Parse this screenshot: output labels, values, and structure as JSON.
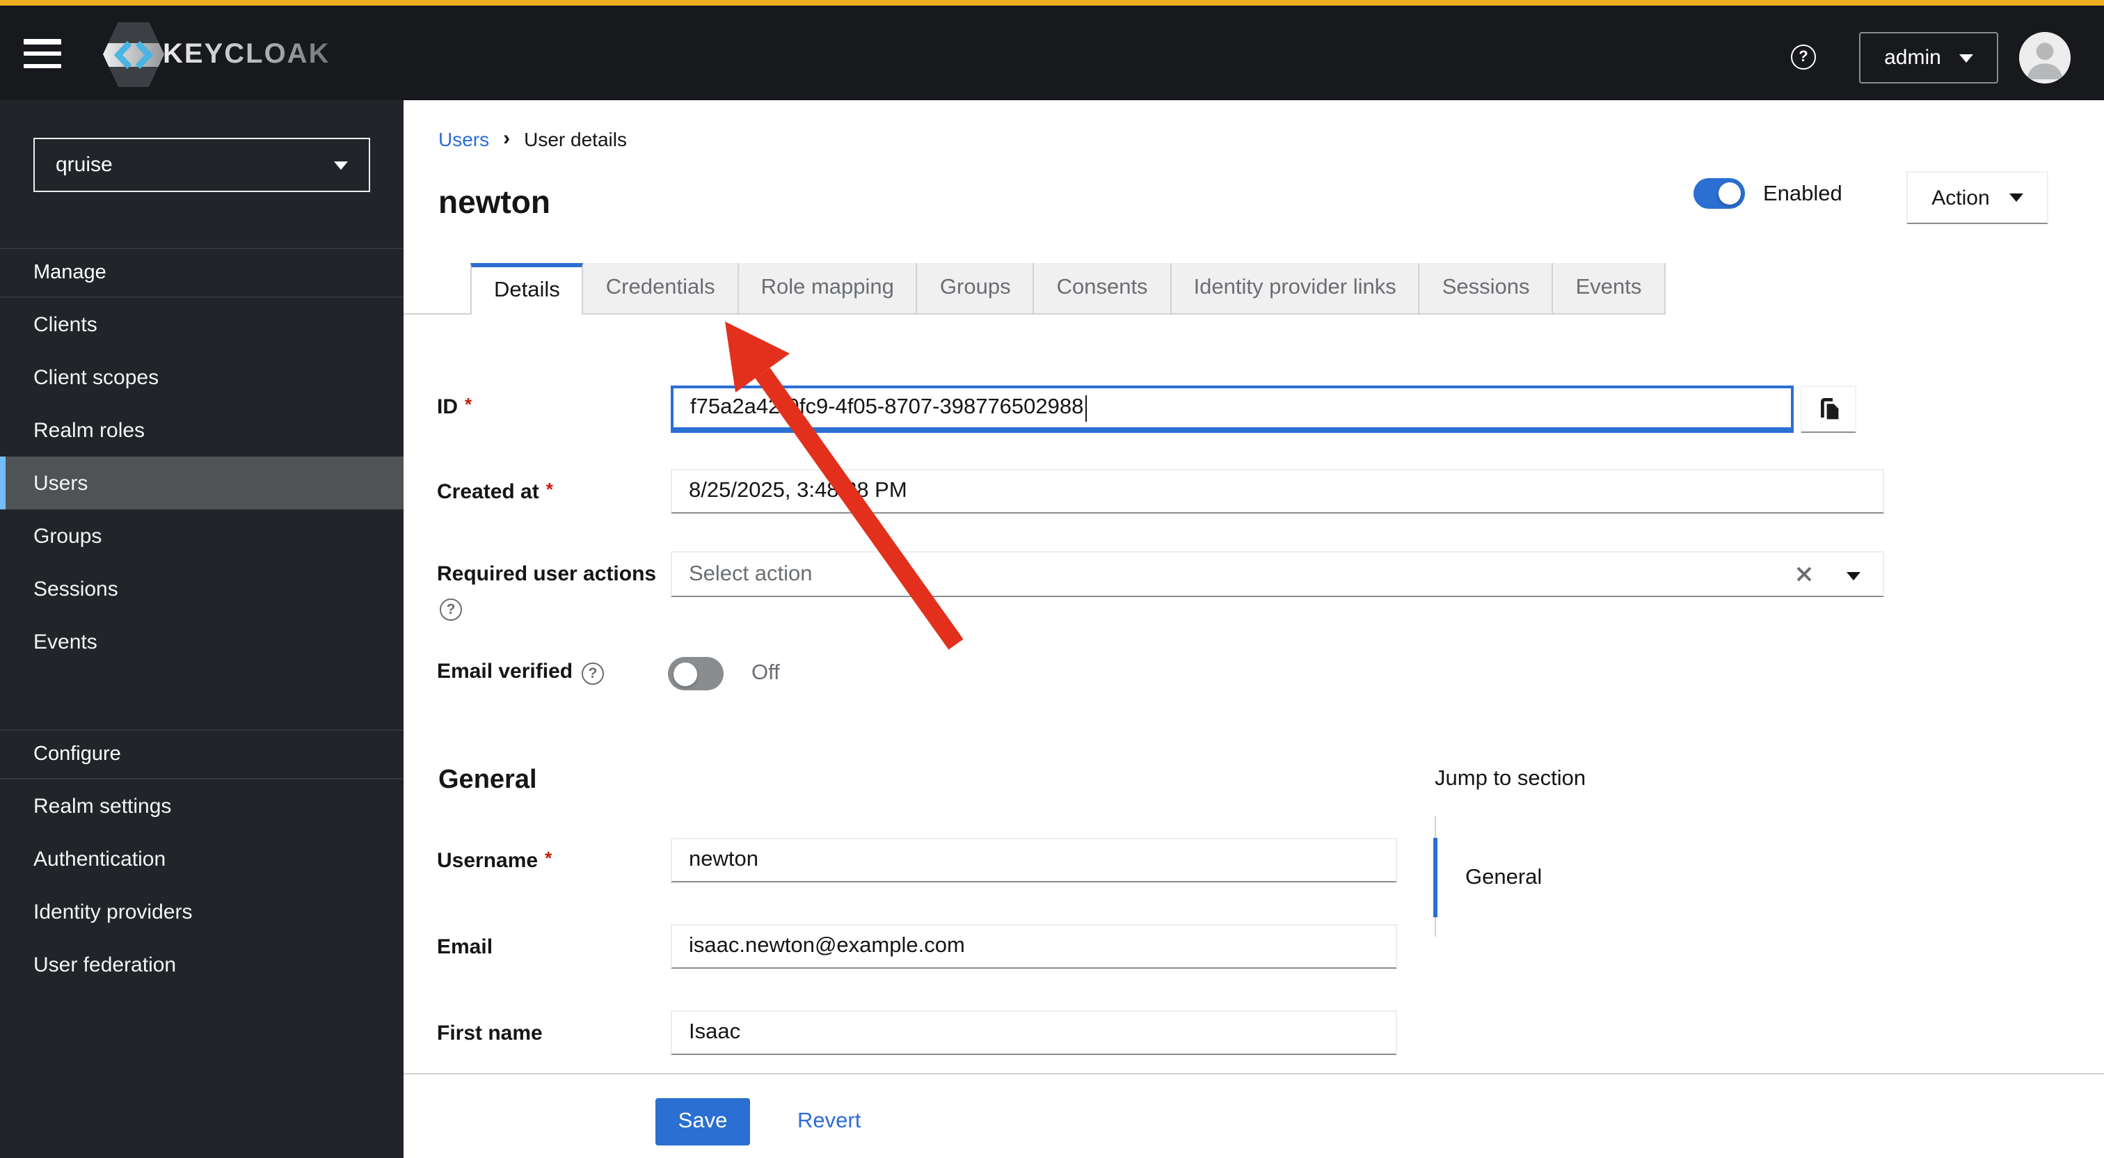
{
  "colors": {
    "accent": "#2a6fd1",
    "link": "#2b6cd9",
    "gold": "#edb021",
    "arrow": "#e2301c",
    "nav-selected": "#73bcf7"
  },
  "header": {
    "brand": "KEYCLOAK",
    "help_glyph": "?",
    "user": "admin"
  },
  "sidebar": {
    "realm": "qruise",
    "manage": {
      "heading": "Manage",
      "items": [
        "Clients",
        "Client scopes",
        "Realm roles",
        "Users",
        "Groups",
        "Sessions",
        "Events"
      ]
    },
    "configure": {
      "heading": "Configure",
      "items": [
        "Realm settings",
        "Authentication",
        "Identity providers",
        "User federation"
      ]
    },
    "selected_item": "Users"
  },
  "breadcrumb": {
    "link": "Users",
    "separator": "›",
    "current": "User details"
  },
  "page": {
    "title": "newton",
    "enabled_label": "Enabled",
    "action_label": "Action"
  },
  "tabs": {
    "items": [
      "Details",
      "Credentials",
      "Role mapping",
      "Groups",
      "Consents",
      "Identity provider links",
      "Sessions",
      "Events"
    ],
    "active": "Details"
  },
  "form": {
    "required_marker": "*",
    "help_glyph": "?",
    "id": {
      "label": "ID",
      "value": "f75a2a42-9fc9-4f05-8707-398776502988"
    },
    "created_at": {
      "label": "Created at",
      "value": "8/25/2025, 3:48:28 PM"
    },
    "required_user_actions": {
      "label": "Required user actions",
      "placeholder": "Select action"
    },
    "email_verified": {
      "label": "Email verified",
      "state": "Off"
    },
    "general_heading": "General",
    "username": {
      "label": "Username",
      "value": "newton"
    },
    "email": {
      "label": "Email",
      "value": "isaac.newton@example.com"
    },
    "first_name": {
      "label": "First name",
      "value": "Isaac"
    }
  },
  "jump": {
    "heading": "Jump to section",
    "items": [
      "General"
    ]
  },
  "actions": {
    "save": "Save",
    "revert": "Revert"
  }
}
